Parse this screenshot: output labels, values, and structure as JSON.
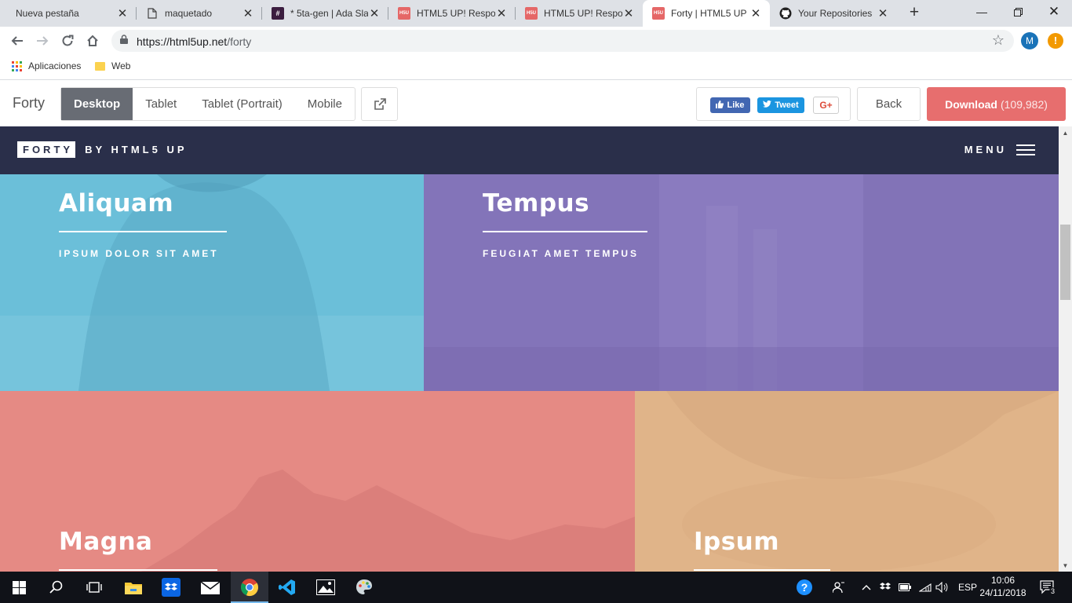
{
  "browser": {
    "tabs": [
      {
        "title": "Nueva pestaña",
        "favicon": "none"
      },
      {
        "title": "maquetado",
        "favicon": "document-icon"
      },
      {
        "title": "* 5ta-gen | Ada Sla",
        "favicon": "slack-hash-icon"
      },
      {
        "title": "HTML5 UP! Respo",
        "favicon": "html5up-icon"
      },
      {
        "title": "HTML5 UP! Respo",
        "favicon": "html5up-icon"
      },
      {
        "title": "Forty | HTML5 UP",
        "favicon": "html5up-icon",
        "active": true
      },
      {
        "title": "Your Repositories",
        "favicon": "github-icon"
      }
    ],
    "url_host": "https://html5up.net",
    "url_path": "/forty",
    "profile_initial": "M",
    "alert_glyph": "!",
    "bookmarks": [
      {
        "label": "Aplicaciones",
        "icon": "apps-grid-icon"
      },
      {
        "label": "Web",
        "icon": "folder-icon"
      }
    ]
  },
  "demo_bar": {
    "brand": "Forty",
    "views": [
      "Desktop",
      "Tablet",
      "Tablet (Portrait)",
      "Mobile"
    ],
    "active_view": "Desktop",
    "like_label": "Like",
    "tweet_label": "Tweet",
    "gplus_label": "G+",
    "back_label": "Back",
    "download_label": "Download",
    "download_count": "(109,982)",
    "download_color": "#e76e6e"
  },
  "site": {
    "logo_box": "FORTY",
    "logo_rest": "BY HTML5 UP",
    "menu_label": "MENU",
    "header_color": "#2a2f4a",
    "tiles": [
      {
        "title": "Aliquam",
        "subtitle": "IPSUM DOLOR SIT AMET",
        "color": "#6bbfd9"
      },
      {
        "title": "Tempus",
        "subtitle": "FEUGIAT AMET TEMPUS",
        "color": "#8a7bbf"
      },
      {
        "title": "Magna",
        "subtitle": "",
        "color": "#e58a84"
      },
      {
        "title": "Ipsum",
        "subtitle": "",
        "color": "#e0b489"
      }
    ]
  },
  "taskbar": {
    "apps": [
      "windows-start-icon",
      "search-icon",
      "task-view-icon",
      "file-explorer-icon",
      "dropbox-icon",
      "mail-icon",
      "chrome-icon",
      "vscode-icon",
      "photos-icon",
      "paint-icon"
    ],
    "active_app": "chrome-icon",
    "language": "ESP",
    "time": "10:06",
    "date": "24/11/2018",
    "notifications": "3"
  }
}
